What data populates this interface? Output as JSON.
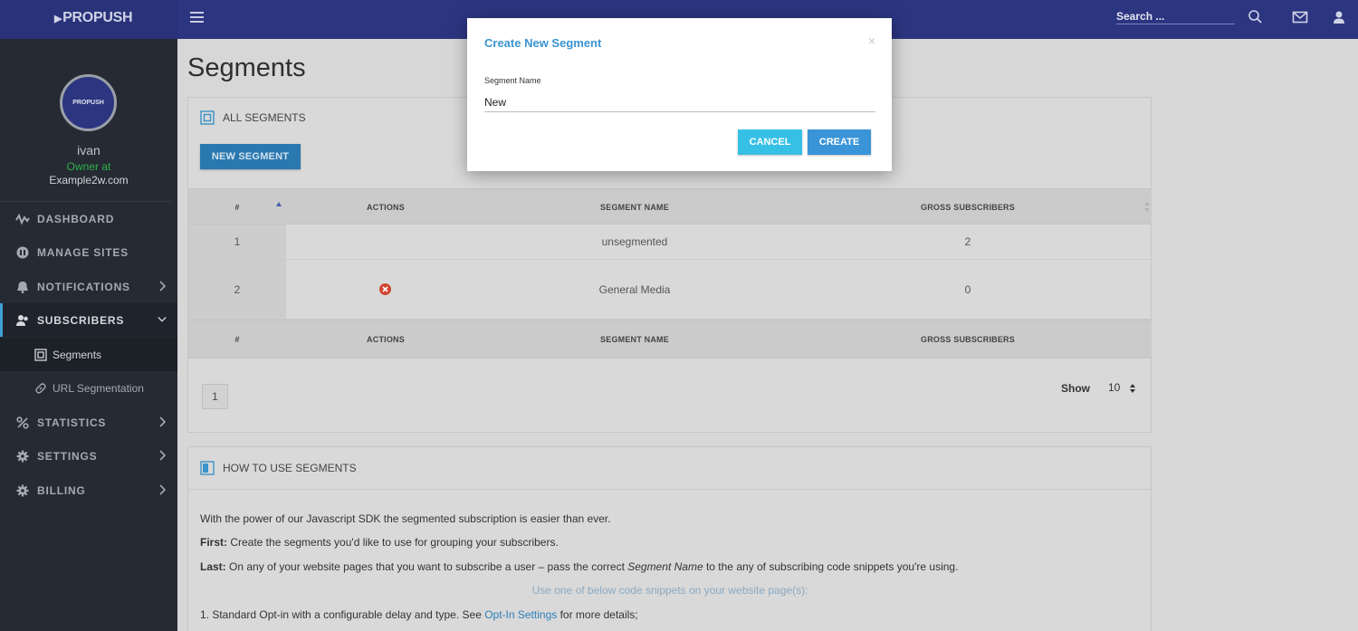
{
  "brand": {
    "logo": "PROPUSH",
    "avatar_text": "PROPUSH"
  },
  "topbar": {
    "search_placeholder": "Search ...",
    "icons": [
      "menu-icon",
      "search-icon",
      "mail-icon",
      "user-icon"
    ]
  },
  "user": {
    "name": "ivan",
    "role": "Owner at",
    "site": "Example2w.com"
  },
  "sidebar": {
    "items": [
      {
        "label": "DASHBOARD",
        "icon": "dashboard-icon"
      },
      {
        "label": "MANAGE SITES",
        "icon": "sites-icon"
      },
      {
        "label": "NOTIFICATIONS",
        "icon": "bell-icon"
      },
      {
        "label": "SUBSCRIBERS",
        "icon": "subscribers-icon"
      },
      {
        "label": "Segments",
        "icon": "segments-icon"
      },
      {
        "label": "URL Segmentation",
        "icon": "link-icon"
      },
      {
        "label": "STATISTICS",
        "icon": "percent-icon"
      },
      {
        "label": "SETTINGS",
        "icon": "gear-icon"
      },
      {
        "label": "BILLING",
        "icon": "gear-icon"
      }
    ],
    "accent": "#3d9fd3"
  },
  "page": {
    "title": "Segments"
  },
  "segments_panel": {
    "header": "ALL SEGMENTS",
    "new_button": "NEW SEGMENT",
    "columns": [
      "#",
      "ACTIONS",
      "SEGMENT NAME",
      "GROSS SUBSCRIBERS"
    ],
    "rows": [
      {
        "num": "1",
        "name": "unsegmented",
        "subscribers": "2"
      },
      {
        "num": "2",
        "name": "General Media",
        "subscribers": "0"
      }
    ],
    "pager": "1",
    "show_label": "Show",
    "page_size": "10"
  },
  "how_panel": {
    "header": "HOW TO USE SEGMENTS",
    "intro": "With the power of our Javascript SDK the segmented subscription is easier than ever.",
    "first_label": "First:",
    "first_text": " Create the segments you'd like to use for grouping your subscribers.",
    "last_label": "Last:",
    "last_text_1": " On any of your website pages that you want to subscribe a user – pass the correct ",
    "last_text_em": "Segment Name",
    "last_text_2": " to the any of subscribing code snippets you're using.",
    "hint": "Use one of below code snippets on your website page(s):",
    "item1_a": "1. Standard Opt-in with a configurable delay and type. See ",
    "item1_link": "Opt-In Settings",
    "item1_b": " for more details;"
  },
  "modal": {
    "title": "Create New Segment",
    "close": "×",
    "field_label": "Segment Name",
    "field_value": "New",
    "cancel": "CANCEL",
    "create": "CREATE"
  }
}
